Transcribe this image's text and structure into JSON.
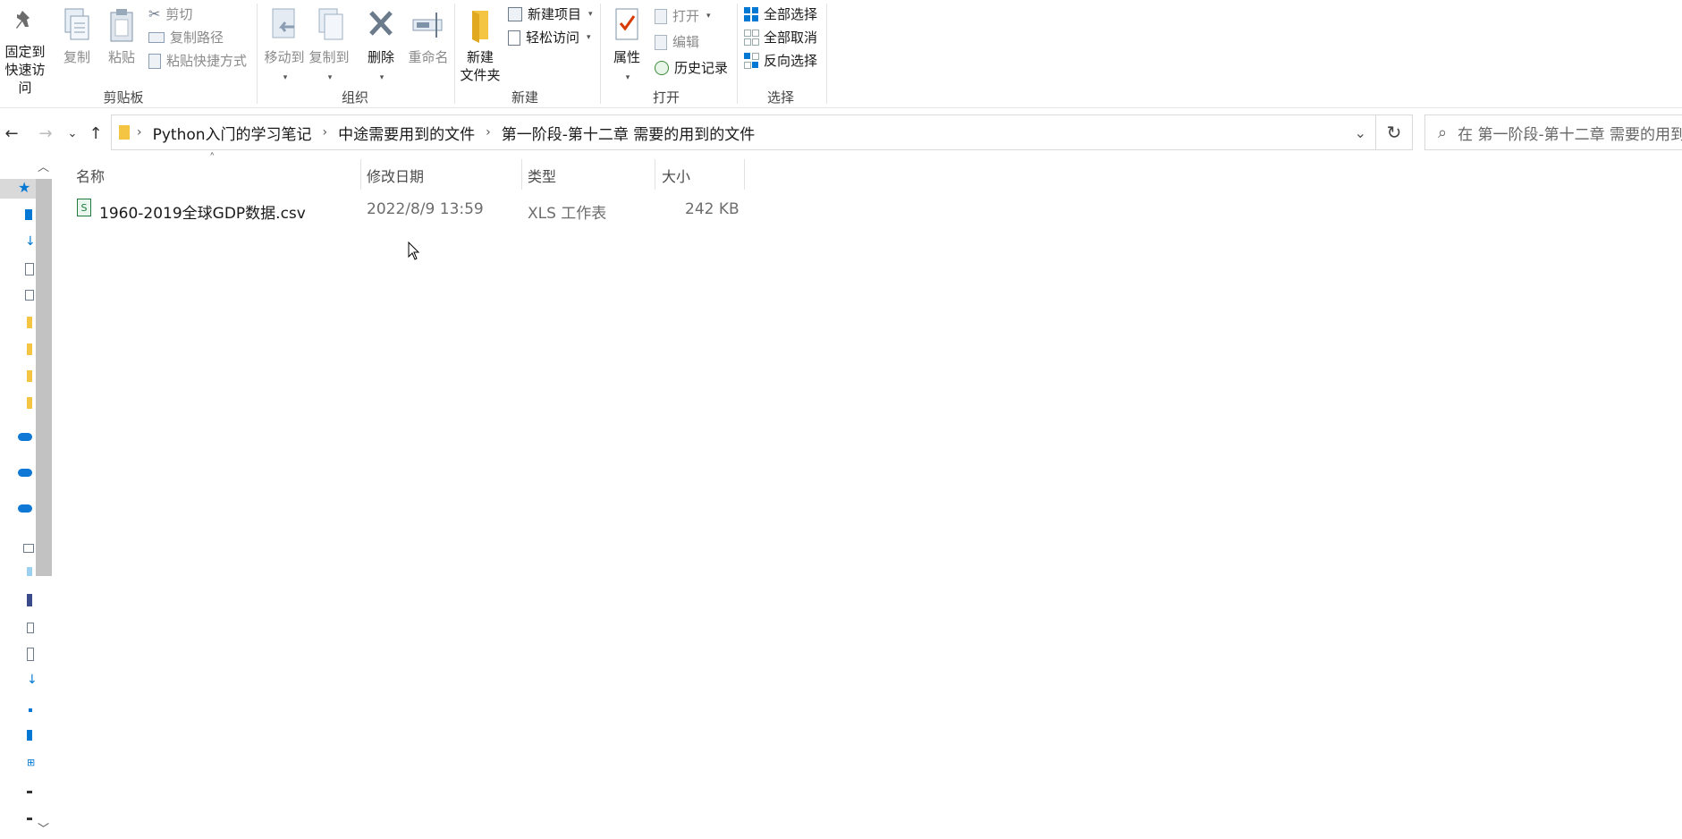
{
  "ribbon": {
    "clipboard": {
      "group_label": "剪贴板",
      "pin_line1": "固定到",
      "pin_line2": "快速访问",
      "copy": "复制",
      "paste": "粘贴",
      "cut": "剪切",
      "copy_path": "复制路径",
      "paste_shortcut": "粘贴快捷方式"
    },
    "organize": {
      "group_label": "组织",
      "move_to": "移动到",
      "copy_to": "复制到",
      "delete": "删除",
      "rename": "重命名"
    },
    "new": {
      "group_label": "新建",
      "new_folder_line1": "新建",
      "new_folder_line2": "文件夹",
      "new_item": "新建项目",
      "easy_access": "轻松访问"
    },
    "open": {
      "group_label": "打开",
      "properties": "属性",
      "open": "打开",
      "edit": "编辑",
      "history": "历史记录"
    },
    "select": {
      "group_label": "选择",
      "select_all": "全部选择",
      "select_none": "全部取消",
      "invert": "反向选择"
    }
  },
  "address": {
    "crumbs": [
      "Python入门的学习笔记",
      "中途需要用到的文件",
      "第一阶段-第十二章 需要的用到的文件"
    ],
    "search_placeholder": "在 第一阶段-第十二章 需要的用到的文件 中搜索"
  },
  "columns": {
    "name": "名称",
    "modified": "修改日期",
    "type": "类型",
    "size": "大小"
  },
  "files": [
    {
      "name": "1960-2019全球GDP数据.csv",
      "modified": "2022/8/9 13:59",
      "type": "XLS 工作表",
      "size": "242 KB"
    }
  ],
  "colors": {
    "accent": "#0078d4",
    "folder": "#f4c542",
    "delete_x": "#6b7b8c",
    "onedrive": "#0f78d4"
  }
}
